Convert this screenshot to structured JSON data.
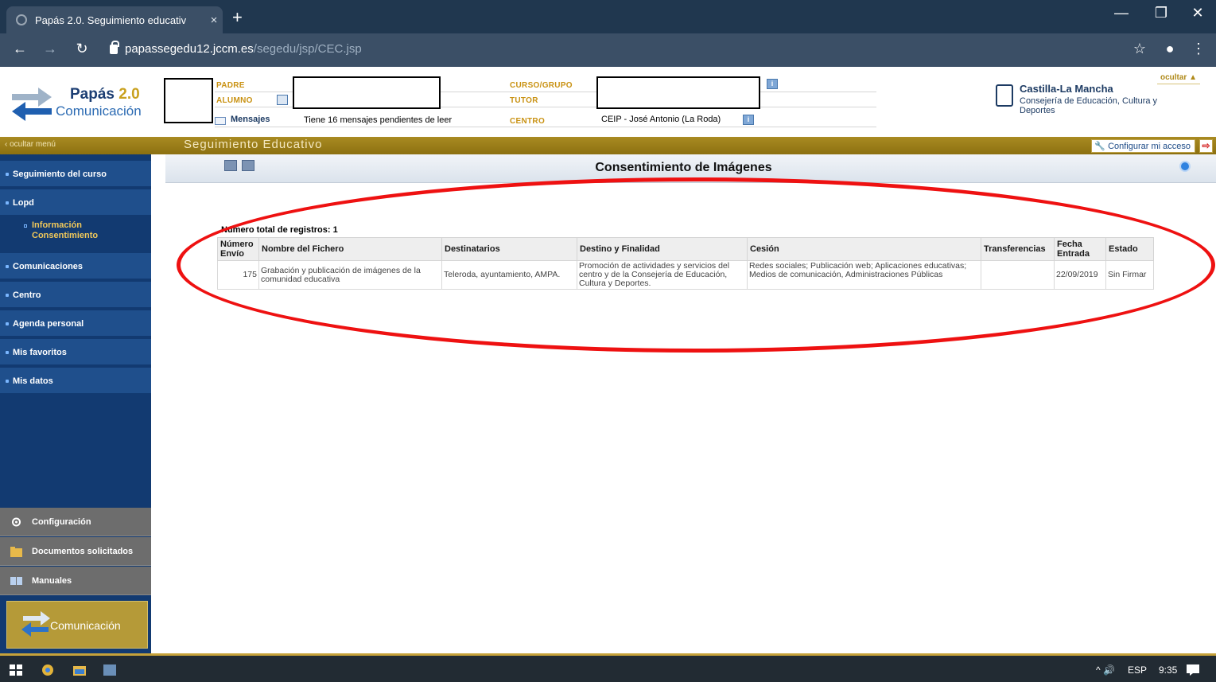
{
  "browser": {
    "tab_title": "Papás 2.0. Seguimiento educativ",
    "tab_close": "×",
    "new_tab": "+",
    "url_host": "papassegedu12.jccm.es",
    "url_path": "/segedu/jsp/CEC.jsp",
    "minimize": "—",
    "restore": "❐",
    "close": "✕"
  },
  "header": {
    "brand_main": "Papás",
    "brand_version": "2.0",
    "brand_sub": "Comunicación",
    "labels": {
      "padre": "PADRE",
      "alumno": "ALUMNO",
      "curso_grupo": "CURSO/GRUPO",
      "tutor": "TUTOR",
      "centro": "CENTRO"
    },
    "mensajes_label": "Mensajes",
    "mensajes_text": "Tiene 16 mensajes pendientes de leer",
    "centro_value": "CEIP - José Antonio (La Roda)",
    "ocultar": "ocultar ▲",
    "gov_title": "Castilla-La Mancha",
    "gov_subtitle": "Consejería de Educación, Cultura y Deportes"
  },
  "goldbar": {
    "hide_menu": "‹  ocultar menú",
    "section_title": "Seguimiento Educativo",
    "config_access": "Configurar mi acceso"
  },
  "sidebar": {
    "items": [
      {
        "label": "Seguimiento del curso"
      },
      {
        "label": "Lopd"
      },
      {
        "label": "Comunicaciones"
      },
      {
        "label": "Centro"
      },
      {
        "label": "Agenda personal"
      },
      {
        "label": "Mis favoritos"
      },
      {
        "label": "Mis datos"
      }
    ],
    "sub_item_line1": "Información",
    "sub_item_line2": "Consentimiento",
    "bottom": [
      {
        "label": "Configuración"
      },
      {
        "label": "Documentos solicitados"
      },
      {
        "label": "Manuales"
      }
    ],
    "footer_logo_text": "Comunicación"
  },
  "content": {
    "title": "Consentimiento de Imágenes",
    "records_count": "Número total de registros: 1",
    "table": {
      "headers": [
        "Número Envío",
        "Nombre del Fichero",
        "Destinatarios",
        "Destino y Finalidad",
        "Cesión",
        "Transferencias",
        "Fecha Entrada",
        "Estado"
      ],
      "rows": [
        [
          "175",
          "Grabación y publicación de imágenes de la comunidad educativa",
          "Teleroda, ayuntamiento, AMPA.",
          "Promoción de actividades y servicios del centro y de la Consejería de Educación, Cultura y Deportes.",
          "Redes sociales; Publicación web; Aplicaciones educativas; Medios de comunicación, Administraciones Públicas",
          "",
          "22/09/2019",
          "Sin Firmar"
        ]
      ]
    }
  },
  "taskbar": {
    "lang": "ESP",
    "time": "9:35",
    "tray": "^  🔊"
  },
  "colors": {
    "sidebar_bg": "#123a71",
    "sidebar_item": "#1f4f8c",
    "gold": "#a98b22",
    "highlight_ellipse": "#ee1111"
  }
}
